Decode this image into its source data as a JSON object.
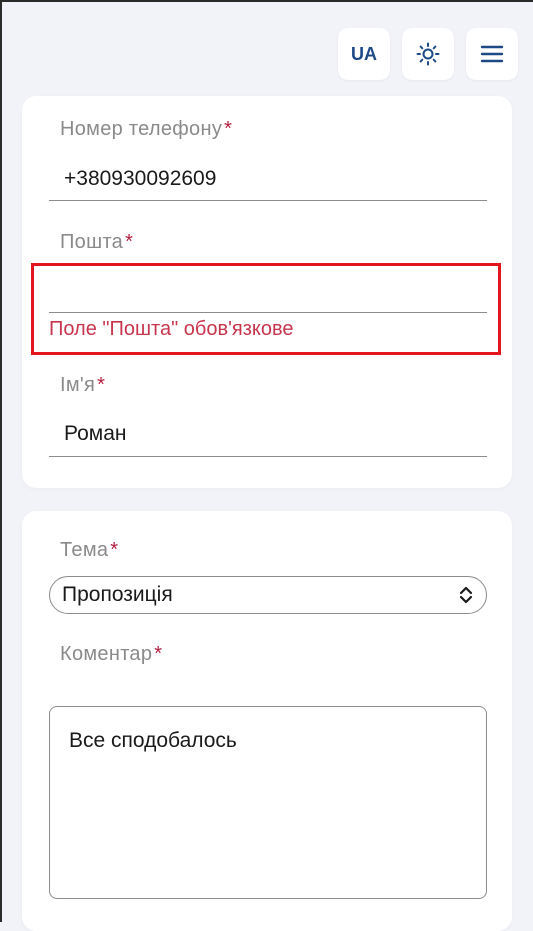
{
  "header": {
    "language": "UA",
    "theme_icon": "sun-icon",
    "menu_icon": "hamburger-menu-icon",
    "accent_color": "#1d4a86"
  },
  "contact_form": {
    "phone": {
      "label": "Номер телефону",
      "required_mark": "*",
      "value": "+380930092609"
    },
    "email": {
      "label": "Пошта",
      "required_mark": "*",
      "value": "",
      "error": "Поле \"Пошта\" обов'язкове"
    },
    "name": {
      "label": "Ім'я",
      "required_mark": "*",
      "value": "Роман"
    }
  },
  "message_form": {
    "topic": {
      "label": "Тема",
      "required_mark": "*",
      "selected": "Пропозиція"
    },
    "comment": {
      "label": "Коментар",
      "required_mark": "*",
      "value": "Все сподобалось"
    }
  },
  "colors": {
    "required": "#b0203e",
    "error_text": "#c8364d",
    "error_highlight": "#e3161d"
  }
}
